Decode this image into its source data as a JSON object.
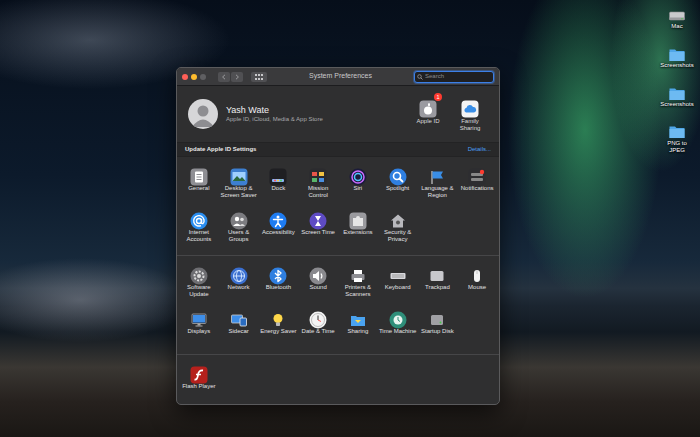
{
  "desktop": {
    "items": [
      {
        "label": "Mac",
        "kind": "drive"
      },
      {
        "label": "Screenshots",
        "kind": "folder"
      },
      {
        "label": "Screenshots",
        "kind": "folder"
      },
      {
        "label": "PNG to JPEG",
        "kind": "folder"
      }
    ]
  },
  "window": {
    "title": "System Preferences",
    "search": {
      "placeholder": "Search",
      "focused": true
    }
  },
  "account": {
    "name": "Yash Wate",
    "subtitle": "Apple ID, iCloud, Media & App Store",
    "buttons": [
      {
        "label": "Apple ID",
        "badge": "1"
      },
      {
        "label": "Family Sharing"
      }
    ]
  },
  "notice": {
    "text": "Update Apple ID Settings",
    "link": "Details..."
  },
  "sections": [
    {
      "items": [
        {
          "label": "General"
        },
        {
          "label": "Desktop & Screen Saver"
        },
        {
          "label": "Dock"
        },
        {
          "label": "Mission Control"
        },
        {
          "label": "Siri"
        },
        {
          "label": "Spotlight"
        },
        {
          "label": "Language & Region"
        },
        {
          "label": "Notifications"
        },
        {
          "label": "Internet Accounts"
        },
        {
          "label": "Users & Groups"
        },
        {
          "label": "Accessibility"
        },
        {
          "label": "Screen Time"
        },
        {
          "label": "Extensions"
        },
        {
          "label": "Security & Privacy"
        }
      ]
    },
    {
      "items": [
        {
          "label": "Software Update"
        },
        {
          "label": "Network"
        },
        {
          "label": "Bluetooth"
        },
        {
          "label": "Sound"
        },
        {
          "label": "Printers & Scanners"
        },
        {
          "label": "Keyboard"
        },
        {
          "label": "Trackpad"
        },
        {
          "label": "Mouse"
        },
        {
          "label": "Displays"
        },
        {
          "label": "Sidecar"
        },
        {
          "label": "Energy Saver"
        },
        {
          "label": "Date & Time"
        },
        {
          "label": "Sharing"
        },
        {
          "label": "Time Machine"
        },
        {
          "label": "Startup Disk"
        }
      ]
    },
    {
      "items": [
        {
          "label": "Flash Player"
        }
      ]
    }
  ]
}
